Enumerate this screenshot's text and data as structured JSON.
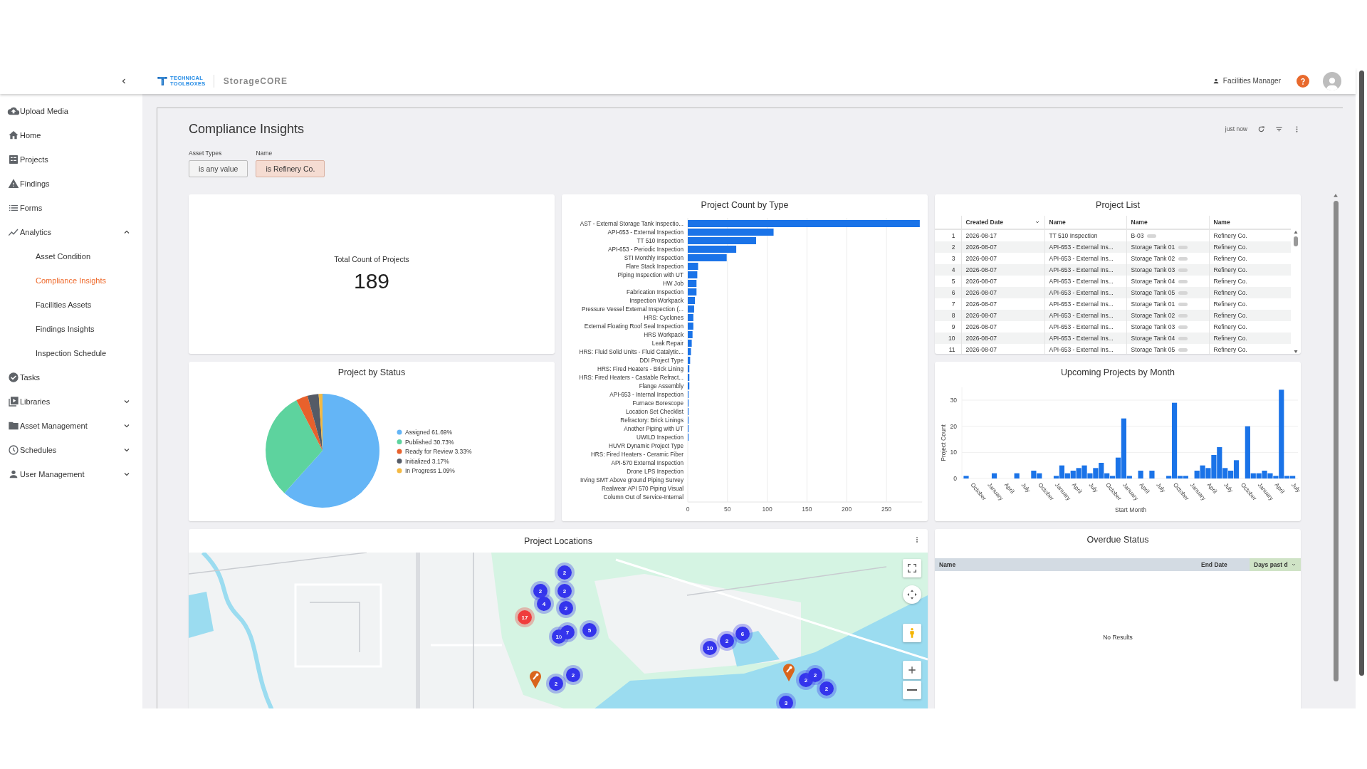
{
  "header": {
    "logo": {
      "mark_lines": [
        "TECHNICAL",
        "TOOLBOXES"
      ],
      "product": "StorageCORE"
    },
    "user": "Facilities Manager"
  },
  "sidebar": {
    "items": [
      {
        "label": "Upload Media",
        "kind": "link",
        "selected": false
      },
      {
        "label": "Home",
        "kind": "link",
        "selected": false
      },
      {
        "label": "Projects",
        "kind": "link",
        "selected": false
      },
      {
        "label": "Findings",
        "kind": "link",
        "selected": false
      },
      {
        "label": "Forms",
        "kind": "link",
        "selected": false
      },
      {
        "label": "Analytics",
        "kind": "group",
        "selected": false,
        "expanded": true,
        "children": [
          {
            "label": "Asset Condition",
            "selected": false
          },
          {
            "label": "Compliance Insights",
            "selected": true
          },
          {
            "label": "Facilities Assets",
            "selected": false
          },
          {
            "label": "Findings Insights",
            "selected": false
          },
          {
            "label": "Inspection Schedule",
            "selected": false
          }
        ]
      },
      {
        "label": "Tasks",
        "kind": "link",
        "selected": false
      },
      {
        "label": "Libraries",
        "kind": "group",
        "selected": false,
        "expanded": false
      },
      {
        "label": "Asset Management",
        "kind": "group",
        "selected": false,
        "expanded": false
      },
      {
        "label": "Schedules",
        "kind": "group",
        "selected": false,
        "expanded": false
      },
      {
        "label": "User Management",
        "kind": "group",
        "selected": false,
        "expanded": false
      }
    ]
  },
  "dashboard": {
    "title": "Compliance Insights",
    "refreshed": "just now",
    "filters": [
      {
        "label": "Asset Types",
        "value": "is any value",
        "active": false
      },
      {
        "label": "Name",
        "value": "is Refinery Co.",
        "active": true
      }
    ]
  },
  "total_count": {
    "title": "Total Count of Projects",
    "value": "189"
  },
  "project_count_by_type": {
    "title": "Project Count by Type",
    "chart_data": {
      "type": "bar",
      "orientation": "horizontal",
      "grid": true,
      "categories": [
        "AST - External Storage Tank Inspectio...",
        "API-653 - External Inspection",
        "TT 510 Inspection",
        "API-653 - Periodic Inspection",
        "STI Monthly Inspection",
        "Flare Stack Inspection",
        "Piping Inspection with UT",
        "HW Job",
        "Fabrication Inspection",
        "Inspection Workpack",
        "Pressure Vessel External Inspection (...",
        "HRS: Cyclones",
        "External Floating Roof Seal Inspection",
        "HRS Workpack",
        "Leak Repair",
        "HRS: Fluid Solid Units - Fluid Catalytic...",
        "DDI Project Type",
        "HRS: Fired Heaters - Brick Lining",
        "HRS: Fired Heaters - Castable Refract...",
        "Flange Assembly",
        "API-653 - Internal Inspection",
        "Furnace Borescope",
        "Location Set Checklist",
        "Refractory: Brick Linings",
        "Another Piping with UT",
        "UWILD Inspection",
        "HUVR Dynamic Project Type",
        "HRS: Fired Heaters - Ceramic Fiber",
        "API-570 External Inspection",
        "Drone LPS Inspection",
        "Irving SMT Above ground Piping Survey",
        "Realwear API 570 Piping Visual",
        "Column Out of Service-Internal"
      ],
      "series": [
        {
          "color": "#1a73e8",
          "values": [
            292,
            108,
            86,
            61,
            49,
            13,
            12,
            11,
            11,
            9,
            8,
            7,
            7,
            6,
            5,
            4,
            3,
            2,
            2,
            2,
            1,
            1,
            1,
            1,
            1,
            1,
            0,
            0,
            0,
            0,
            0,
            0,
            0
          ]
        }
      ],
      "xlim": [
        0,
        295
      ],
      "xticks": [
        0,
        50,
        100,
        150,
        200,
        250
      ]
    }
  },
  "project_list": {
    "title": "Project List",
    "columns": [
      {
        "label": "Created Date",
        "sorted": true
      },
      {
        "label": "Name",
        "sorted": false
      },
      {
        "label": "Name",
        "sorted": false
      },
      {
        "label": "Name",
        "sorted": false
      }
    ],
    "rows": [
      {
        "number": "1",
        "created_date": "2026-08-17",
        "project": "TT 510 Inspection",
        "asset": "B-03",
        "company": "Refinery Co."
      },
      {
        "number": "2",
        "created_date": "2026-08-07",
        "project": "API-653 - External Ins...",
        "asset": "Storage Tank 01",
        "company": "Refinery Co."
      },
      {
        "number": "3",
        "created_date": "2026-08-07",
        "project": "API-653 - External Ins...",
        "asset": "Storage Tank 02",
        "company": "Refinery Co."
      },
      {
        "number": "4",
        "created_date": "2026-08-07",
        "project": "API-653 - External Ins...",
        "asset": "Storage Tank 03",
        "company": "Refinery Co."
      },
      {
        "number": "5",
        "created_date": "2026-08-07",
        "project": "API-653 - External Ins...",
        "asset": "Storage Tank 04",
        "company": "Refinery Co."
      },
      {
        "number": "6",
        "created_date": "2026-08-07",
        "project": "API-653 - External Ins...",
        "asset": "Storage Tank 05",
        "company": "Refinery Co."
      },
      {
        "number": "7",
        "created_date": "2026-08-07",
        "project": "API-653 - External Ins...",
        "asset": "Storage Tank 01",
        "company": "Refinery Co."
      },
      {
        "number": "8",
        "created_date": "2026-08-07",
        "project": "API-653 - External Ins...",
        "asset": "Storage Tank 02",
        "company": "Refinery Co."
      },
      {
        "number": "9",
        "created_date": "2026-08-07",
        "project": "API-653 - External Ins...",
        "asset": "Storage Tank 03",
        "company": "Refinery Co."
      },
      {
        "number": "10",
        "created_date": "2026-08-07",
        "project": "API-653 - External Ins...",
        "asset": "Storage Tank 04",
        "company": "Refinery Co."
      },
      {
        "number": "11",
        "created_date": "2026-08-07",
        "project": "API-653 - External Ins...",
        "asset": "Storage Tank 05",
        "company": "Refinery Co."
      }
    ]
  },
  "project_by_status": {
    "title": "Project by Status",
    "chart_data": {
      "type": "pie",
      "categories": [
        "Assigned 61.69%",
        "Published 30.73%",
        "Ready for Review 3.33%",
        "Initialized 3.17%",
        "In Progress 1.09%"
      ],
      "values": [
        61.69,
        30.73,
        3.33,
        3.17,
        1.09
      ],
      "legend": "right"
    },
    "legend": [
      {
        "color": "#64b5f6"
      },
      {
        "color": "#5dd39e"
      },
      {
        "color": "#e8612c"
      },
      {
        "color": "#555b66"
      },
      {
        "color": "#f4b942"
      }
    ]
  },
  "upcoming_projects": {
    "title": "Upcoming Projects by Month",
    "chart_data": {
      "type": "bar",
      "xlabel": "Start Month",
      "ylabel": "Project Count",
      "categories": [
        null,
        "October",
        null,
        null,
        "January",
        null,
        null,
        "April",
        null,
        null,
        "July",
        null,
        null,
        "October",
        null,
        null,
        "January",
        null,
        null,
        "April",
        null,
        null,
        "July",
        null,
        null,
        "October",
        null,
        null,
        "January",
        null,
        null,
        "April",
        null,
        null,
        "July",
        null,
        null,
        "October",
        null,
        null,
        "January",
        null,
        null,
        "April",
        null,
        null,
        "July",
        null,
        null,
        "October",
        null,
        null,
        "January",
        null,
        null,
        "April",
        null,
        null,
        "July"
      ],
      "series": [
        {
          "color": "#1a73e8",
          "values": [
            1,
            0,
            0,
            0,
            0,
            2,
            0,
            0,
            0,
            2,
            0,
            0,
            3,
            2,
            0,
            0,
            1,
            5,
            2,
            3,
            4,
            5,
            2,
            4,
            6,
            2,
            1,
            8,
            23,
            1,
            0,
            3,
            0,
            3,
            0,
            0,
            1,
            29,
            1,
            1,
            0,
            3,
            5,
            4,
            9,
            12,
            4,
            3,
            7,
            0,
            20,
            2,
            2,
            3,
            2,
            1,
            34,
            1,
            1
          ]
        }
      ],
      "grid": true,
      "ylim": [
        0,
        35
      ],
      "yticks": [
        0,
        10,
        20,
        30
      ]
    }
  },
  "project_locations": {
    "title": "Project Locations",
    "markers": [
      {
        "kind": "cluster",
        "label": "2"
      },
      {
        "kind": "cluster",
        "label": "2"
      },
      {
        "kind": "cluster",
        "label": "2"
      },
      {
        "kind": "cluster",
        "label": "4"
      },
      {
        "kind": "cluster",
        "label": "2"
      },
      {
        "kind": "alert",
        "label": "17"
      },
      {
        "kind": "cluster",
        "label": "10"
      },
      {
        "kind": "cluster",
        "label": "7"
      },
      {
        "kind": "cluster",
        "label": "5"
      },
      {
        "kind": "cluster",
        "label": "10"
      },
      {
        "kind": "cluster",
        "label": "2"
      },
      {
        "kind": "cluster",
        "label": "6"
      },
      {
        "kind": "pin"
      },
      {
        "kind": "cluster",
        "label": "2"
      },
      {
        "kind": "cluster",
        "label": "2"
      },
      {
        "kind": "pin"
      },
      {
        "kind": "cluster",
        "label": "2"
      },
      {
        "kind": "cluster",
        "label": "2"
      },
      {
        "kind": "cluster",
        "label": "2"
      },
      {
        "kind": "cluster",
        "label": "3"
      }
    ]
  },
  "overdue_status": {
    "title": "Overdue Status",
    "columns": [
      {
        "label": "Name",
        "highlighted": false,
        "sorted": false
      },
      {
        "label": "End Date",
        "highlighted": false,
        "sorted": false
      },
      {
        "label": "Days past d",
        "highlighted": true,
        "sorted": true
      }
    ],
    "empty_text": "No Results"
  }
}
